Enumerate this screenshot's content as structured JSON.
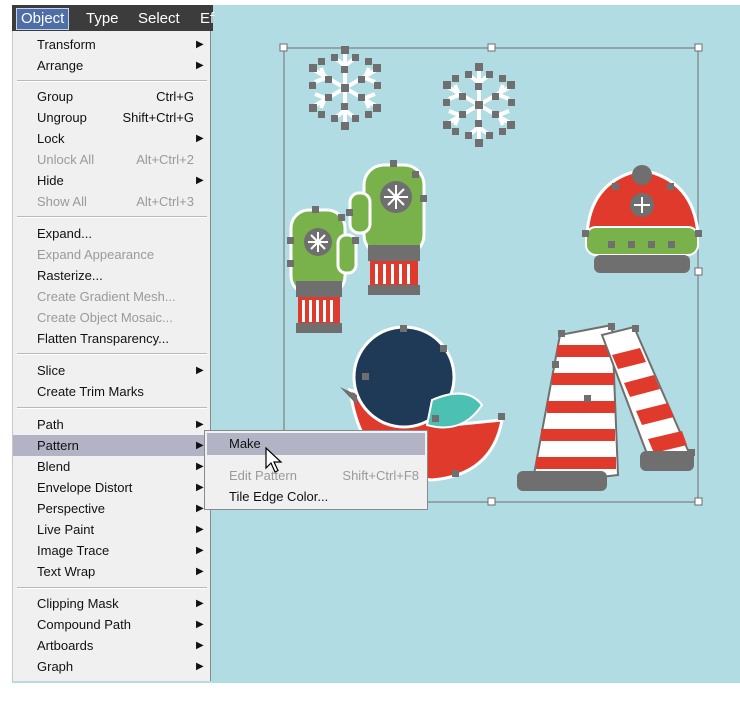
{
  "menubar": {
    "items": [
      {
        "label": "Object"
      },
      {
        "label": "Type"
      },
      {
        "label": "Select"
      },
      {
        "label": "Ef"
      }
    ]
  },
  "object_menu": {
    "items": [
      {
        "label": "Transform",
        "submenu": true
      },
      {
        "label": "Arrange",
        "submenu": true
      },
      {
        "label": "Group",
        "shortcut": "Ctrl+G"
      },
      {
        "label": "Ungroup",
        "shortcut": "Shift+Ctrl+G"
      },
      {
        "label": "Lock",
        "submenu": true
      },
      {
        "label": "Unlock All",
        "shortcut": "Alt+Ctrl+2",
        "disabled": true
      },
      {
        "label": "Hide",
        "submenu": true
      },
      {
        "label": "Show All",
        "shortcut": "Alt+Ctrl+3",
        "disabled": true
      },
      {
        "label": "Expand..."
      },
      {
        "label": "Expand Appearance",
        "disabled": true
      },
      {
        "label": "Rasterize..."
      },
      {
        "label": "Create Gradient Mesh...",
        "disabled": true
      },
      {
        "label": "Create Object Mosaic...",
        "disabled": true
      },
      {
        "label": "Flatten Transparency..."
      },
      {
        "label": "Slice",
        "submenu": true
      },
      {
        "label": "Create Trim Marks"
      },
      {
        "label": "Path",
        "submenu": true
      },
      {
        "label": "Pattern",
        "submenu": true,
        "highlighted": true
      },
      {
        "label": "Blend",
        "submenu": true
      },
      {
        "label": "Envelope Distort",
        "submenu": true
      },
      {
        "label": "Perspective",
        "submenu": true
      },
      {
        "label": "Live Paint",
        "submenu": true
      },
      {
        "label": "Image Trace",
        "submenu": true
      },
      {
        "label": "Text Wrap",
        "submenu": true
      },
      {
        "label": "Clipping Mask",
        "submenu": true
      },
      {
        "label": "Compound Path",
        "submenu": true
      },
      {
        "label": "Artboards",
        "submenu": true
      },
      {
        "label": "Graph",
        "submenu": true
      }
    ]
  },
  "pattern_submenu": {
    "items": [
      {
        "label": "Make",
        "highlighted": true
      },
      {
        "label": "Edit Pattern",
        "shortcut": "Shift+Ctrl+F8",
        "disabled": true
      },
      {
        "label": "Tile Edge Color..."
      }
    ]
  },
  "colors": {
    "canvas": "#b1dce3",
    "menubar": "#3c3c3c",
    "menu_bg": "#f0f0f0",
    "highlight": "#b3b3c6",
    "anchor": "#6f6f6f",
    "green": "#79b24a",
    "red": "#e03a2c",
    "navy": "#1e3a57",
    "teal": "#4cc0b2"
  }
}
